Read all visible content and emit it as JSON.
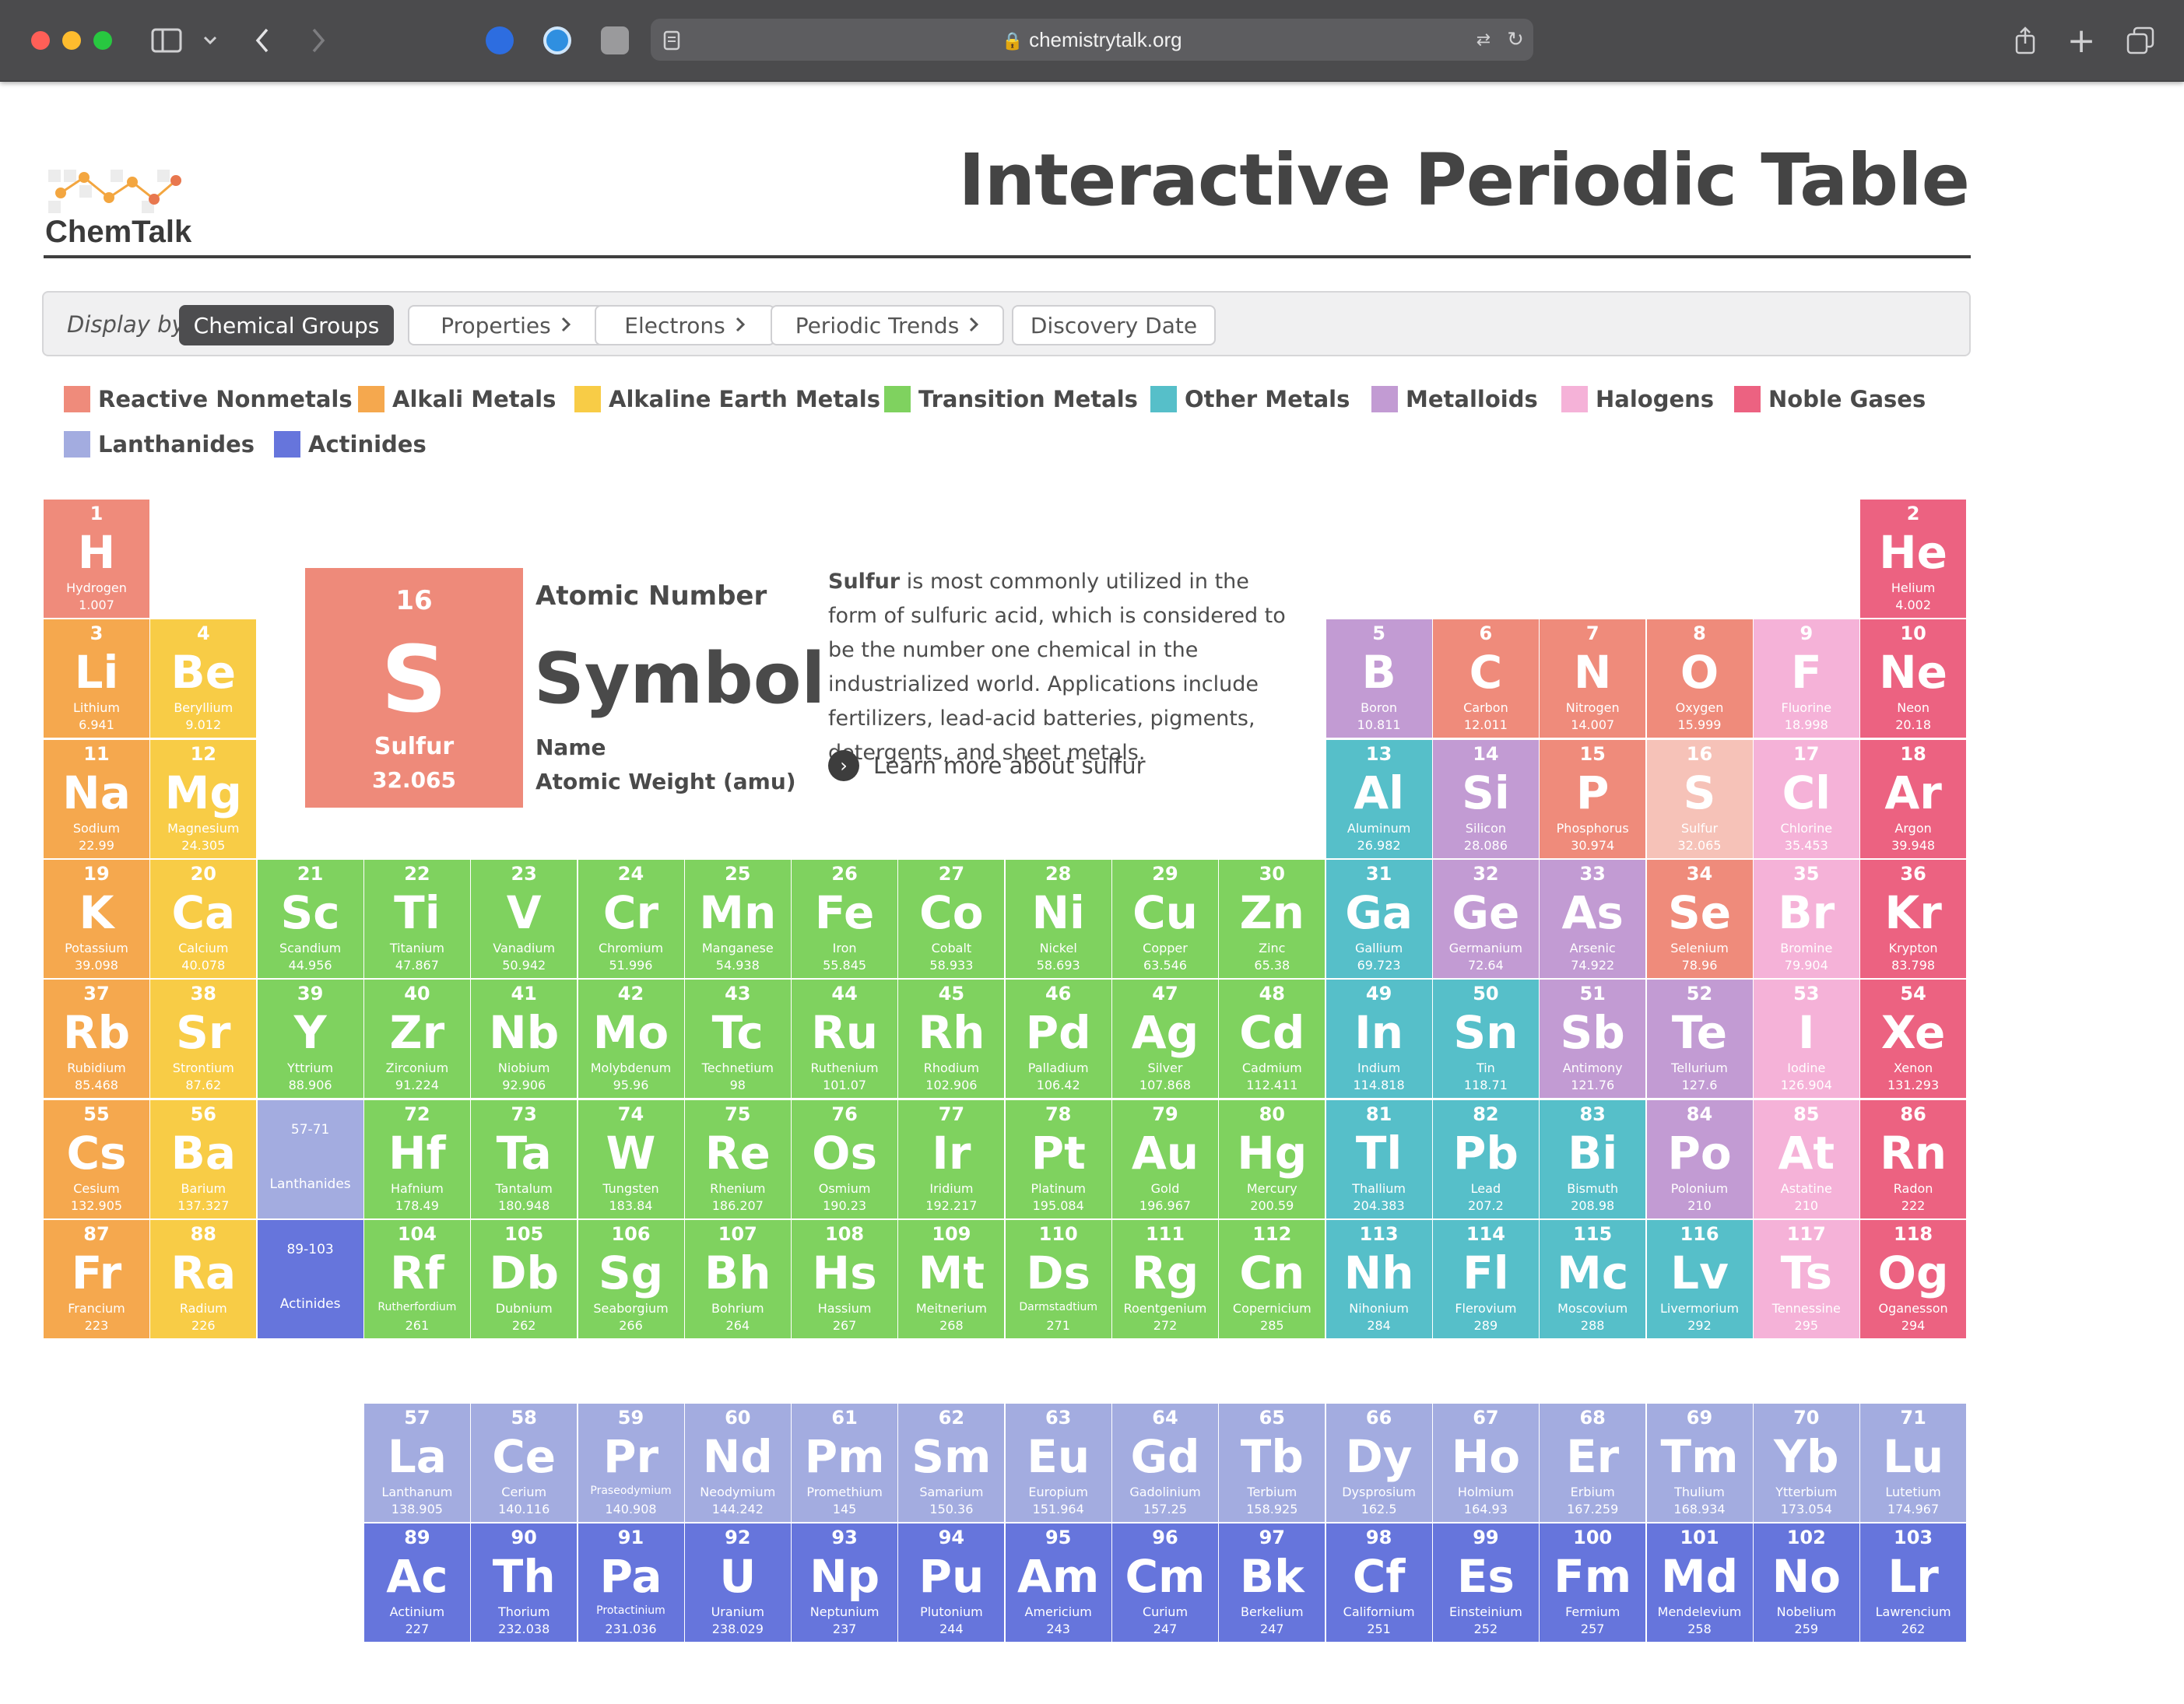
{
  "browser": {
    "url": "chemistrytalk.org"
  },
  "header": {
    "logo_text": "ChemTalk",
    "title": "Interactive Periodic Table"
  },
  "display_bar": {
    "label": "Display by",
    "buttons": [
      {
        "label": "Chemical Groups",
        "chevron": false,
        "active": true
      },
      {
        "label": "Properties",
        "chevron": true,
        "active": false
      },
      {
        "label": "Electrons",
        "chevron": true,
        "active": false
      },
      {
        "label": "Periodic Trends",
        "chevron": true,
        "active": false
      },
      {
        "label": "Discovery Date",
        "chevron": false,
        "active": false
      }
    ]
  },
  "legend": [
    {
      "key": "rn",
      "label": "Reactive Nonmetals"
    },
    {
      "key": "am",
      "label": "Alkali Metals"
    },
    {
      "key": "ae",
      "label": "Alkaline Earth Metals"
    },
    {
      "key": "tm",
      "label": "Transition Metals"
    },
    {
      "key": "om",
      "label": "Other Metals"
    },
    {
      "key": "md",
      "label": "Metalloids"
    },
    {
      "key": "ha",
      "label": "Halogens"
    },
    {
      "key": "ng",
      "label": "Noble Gases"
    },
    {
      "key": "la",
      "label": "Lanthanides"
    },
    {
      "key": "ac",
      "label": "Actinides"
    }
  ],
  "colors": {
    "rn": "#ef8b7b",
    "am": "#f5a84e",
    "ae": "#f8cc46",
    "tm": "#7fd25f",
    "om": "#56bfc9",
    "md": "#c29bd3",
    "ha": "#f5b2d8",
    "ng": "#ec6281",
    "la": "#a3ace0",
    "ac": "#6675dc",
    "selected": "#f6c2b8",
    "accent_dark": "#4d4d4f"
  },
  "detail": {
    "number": "16",
    "symbol": "S",
    "name": "Sulfur",
    "weight": "32.065",
    "captions": {
      "number": "Atomic Number",
      "symbol": "Symbol",
      "name": "Name",
      "weight": "Atomic Weight (amu)"
    },
    "description_bold": "Sulfur",
    "description": " is most commonly utilized in the form of sulfuric acid, which is considered to be the number one chemical in the industrialized world. Applications include fertilizers, lead-acid batteries, pigments, detergents, and sheet metals.",
    "link": "Learn more about sulfur"
  },
  "placeholders": [
    {
      "range": "57-71",
      "name": "Lanthanides",
      "cat": "la"
    },
    {
      "range": "89-103",
      "name": "Actinides",
      "cat": "ac"
    }
  ],
  "elements": [
    {
      "n": "1",
      "s": "H",
      "name": "Hydrogen",
      "w": "1.007",
      "cat": "rn"
    },
    {
      "n": "2",
      "s": "He",
      "name": "Helium",
      "w": "4.002",
      "cat": "ng"
    },
    {
      "n": "3",
      "s": "Li",
      "name": "Lithium",
      "w": "6.941",
      "cat": "am"
    },
    {
      "n": "4",
      "s": "Be",
      "name": "Beryllium",
      "w": "9.012",
      "cat": "ae"
    },
    {
      "n": "5",
      "s": "B",
      "name": "Boron",
      "w": "10.811",
      "cat": "md"
    },
    {
      "n": "6",
      "s": "C",
      "name": "Carbon",
      "w": "12.011",
      "cat": "rn"
    },
    {
      "n": "7",
      "s": "N",
      "name": "Nitrogen",
      "w": "14.007",
      "cat": "rn"
    },
    {
      "n": "8",
      "s": "O",
      "name": "Oxygen",
      "w": "15.999",
      "cat": "rn"
    },
    {
      "n": "9",
      "s": "F",
      "name": "Fluorine",
      "w": "18.998",
      "cat": "ha"
    },
    {
      "n": "10",
      "s": "Ne",
      "name": "Neon",
      "w": "20.18",
      "cat": "ng"
    },
    {
      "n": "11",
      "s": "Na",
      "name": "Sodium",
      "w": "22.99",
      "cat": "am"
    },
    {
      "n": "12",
      "s": "Mg",
      "name": "Magnesium",
      "w": "24.305",
      "cat": "ae"
    },
    {
      "n": "13",
      "s": "Al",
      "name": "Aluminum",
      "w": "26.982",
      "cat": "om"
    },
    {
      "n": "14",
      "s": "Si",
      "name": "Silicon",
      "w": "28.086",
      "cat": "md"
    },
    {
      "n": "15",
      "s": "P",
      "name": "Phosphorus",
      "w": "30.974",
      "cat": "rn"
    },
    {
      "n": "16",
      "s": "S",
      "name": "Sulfur",
      "w": "32.065",
      "cat": "selected"
    },
    {
      "n": "17",
      "s": "Cl",
      "name": "Chlorine",
      "w": "35.453",
      "cat": "ha"
    },
    {
      "n": "18",
      "s": "Ar",
      "name": "Argon",
      "w": "39.948",
      "cat": "ng"
    },
    {
      "n": "19",
      "s": "K",
      "name": "Potassium",
      "w": "39.098",
      "cat": "am"
    },
    {
      "n": "20",
      "s": "Ca",
      "name": "Calcium",
      "w": "40.078",
      "cat": "ae"
    },
    {
      "n": "21",
      "s": "Sc",
      "name": "Scandium",
      "w": "44.956",
      "cat": "tm"
    },
    {
      "n": "22",
      "s": "Ti",
      "name": "Titanium",
      "w": "47.867",
      "cat": "tm"
    },
    {
      "n": "23",
      "s": "V",
      "name": "Vanadium",
      "w": "50.942",
      "cat": "tm"
    },
    {
      "n": "24",
      "s": "Cr",
      "name": "Chromium",
      "w": "51.996",
      "cat": "tm"
    },
    {
      "n": "25",
      "s": "Mn",
      "name": "Manganese",
      "w": "54.938",
      "cat": "tm"
    },
    {
      "n": "26",
      "s": "Fe",
      "name": "Iron",
      "w": "55.845",
      "cat": "tm"
    },
    {
      "n": "27",
      "s": "Co",
      "name": "Cobalt",
      "w": "58.933",
      "cat": "tm"
    },
    {
      "n": "28",
      "s": "Ni",
      "name": "Nickel",
      "w": "58.693",
      "cat": "tm"
    },
    {
      "n": "29",
      "s": "Cu",
      "name": "Copper",
      "w": "63.546",
      "cat": "tm"
    },
    {
      "n": "30",
      "s": "Zn",
      "name": "Zinc",
      "w": "65.38",
      "cat": "tm"
    },
    {
      "n": "31",
      "s": "Ga",
      "name": "Gallium",
      "w": "69.723",
      "cat": "om"
    },
    {
      "n": "32",
      "s": "Ge",
      "name": "Germanium",
      "w": "72.64",
      "cat": "md"
    },
    {
      "n": "33",
      "s": "As",
      "name": "Arsenic",
      "w": "74.922",
      "cat": "md"
    },
    {
      "n": "34",
      "s": "Se",
      "name": "Selenium",
      "w": "78.96",
      "cat": "rn"
    },
    {
      "n": "35",
      "s": "Br",
      "name": "Bromine",
      "w": "79.904",
      "cat": "ha"
    },
    {
      "n": "36",
      "s": "Kr",
      "name": "Krypton",
      "w": "83.798",
      "cat": "ng"
    },
    {
      "n": "37",
      "s": "Rb",
      "name": "Rubidium",
      "w": "85.468",
      "cat": "am"
    },
    {
      "n": "38",
      "s": "Sr",
      "name": "Strontium",
      "w": "87.62",
      "cat": "ae"
    },
    {
      "n": "39",
      "s": "Y",
      "name": "Yttrium",
      "w": "88.906",
      "cat": "tm"
    },
    {
      "n": "40",
      "s": "Zr",
      "name": "Zirconium",
      "w": "91.224",
      "cat": "tm"
    },
    {
      "n": "41",
      "s": "Nb",
      "name": "Niobium",
      "w": "92.906",
      "cat": "tm"
    },
    {
      "n": "42",
      "s": "Mo",
      "name": "Molybdenum",
      "w": "95.96",
      "cat": "tm"
    },
    {
      "n": "43",
      "s": "Tc",
      "name": "Technetium",
      "w": "98",
      "cat": "tm"
    },
    {
      "n": "44",
      "s": "Ru",
      "name": "Ruthenium",
      "w": "101.07",
      "cat": "tm"
    },
    {
      "n": "45",
      "s": "Rh",
      "name": "Rhodium",
      "w": "102.906",
      "cat": "tm"
    },
    {
      "n": "46",
      "s": "Pd",
      "name": "Palladium",
      "w": "106.42",
      "cat": "tm"
    },
    {
      "n": "47",
      "s": "Ag",
      "name": "Silver",
      "w": "107.868",
      "cat": "tm"
    },
    {
      "n": "48",
      "s": "Cd",
      "name": "Cadmium",
      "w": "112.411",
      "cat": "tm"
    },
    {
      "n": "49",
      "s": "In",
      "name": "Indium",
      "w": "114.818",
      "cat": "om"
    },
    {
      "n": "50",
      "s": "Sn",
      "name": "Tin",
      "w": "118.71",
      "cat": "om"
    },
    {
      "n": "51",
      "s": "Sb",
      "name": "Antimony",
      "w": "121.76",
      "cat": "md"
    },
    {
      "n": "52",
      "s": "Te",
      "name": "Tellurium",
      "w": "127.6",
      "cat": "md"
    },
    {
      "n": "53",
      "s": "I",
      "name": "Iodine",
      "w": "126.904",
      "cat": "ha"
    },
    {
      "n": "54",
      "s": "Xe",
      "name": "Xenon",
      "w": "131.293",
      "cat": "ng"
    },
    {
      "n": "55",
      "s": "Cs",
      "name": "Cesium",
      "w": "132.905",
      "cat": "am"
    },
    {
      "n": "56",
      "s": "Ba",
      "name": "Barium",
      "w": "137.327",
      "cat": "ae"
    },
    {
      "n": "72",
      "s": "Hf",
      "name": "Hafnium",
      "w": "178.49",
      "cat": "tm"
    },
    {
      "n": "73",
      "s": "Ta",
      "name": "Tantalum",
      "w": "180.948",
      "cat": "tm"
    },
    {
      "n": "74",
      "s": "W",
      "name": "Tungsten",
      "w": "183.84",
      "cat": "tm"
    },
    {
      "n": "75",
      "s": "Re",
      "name": "Rhenium",
      "w": "186.207",
      "cat": "tm"
    },
    {
      "n": "76",
      "s": "Os",
      "name": "Osmium",
      "w": "190.23",
      "cat": "tm"
    },
    {
      "n": "77",
      "s": "Ir",
      "name": "Iridium",
      "w": "192.217",
      "cat": "tm"
    },
    {
      "n": "78",
      "s": "Pt",
      "name": "Platinum",
      "w": "195.084",
      "cat": "tm"
    },
    {
      "n": "79",
      "s": "Au",
      "name": "Gold",
      "w": "196.967",
      "cat": "tm"
    },
    {
      "n": "80",
      "s": "Hg",
      "name": "Mercury",
      "w": "200.59",
      "cat": "tm"
    },
    {
      "n": "81",
      "s": "Tl",
      "name": "Thallium",
      "w": "204.383",
      "cat": "om"
    },
    {
      "n": "82",
      "s": "Pb",
      "name": "Lead",
      "w": "207.2",
      "cat": "om"
    },
    {
      "n": "83",
      "s": "Bi",
      "name": "Bismuth",
      "w": "208.98",
      "cat": "om"
    },
    {
      "n": "84",
      "s": "Po",
      "name": "Polonium",
      "w": "210",
      "cat": "md"
    },
    {
      "n": "85",
      "s": "At",
      "name": "Astatine",
      "w": "210",
      "cat": "ha"
    },
    {
      "n": "86",
      "s": "Rn",
      "name": "Radon",
      "w": "222",
      "cat": "ng"
    },
    {
      "n": "87",
      "s": "Fr",
      "name": "Francium",
      "w": "223",
      "cat": "am"
    },
    {
      "n": "88",
      "s": "Ra",
      "name": "Radium",
      "w": "226",
      "cat": "ae"
    },
    {
      "n": "104",
      "s": "Rf",
      "name": "Rutherfordium",
      "w": "261",
      "cat": "tm"
    },
    {
      "n": "105",
      "s": "Db",
      "name": "Dubnium",
      "w": "262",
      "cat": "tm"
    },
    {
      "n": "106",
      "s": "Sg",
      "name": "Seaborgium",
      "w": "266",
      "cat": "tm"
    },
    {
      "n": "107",
      "s": "Bh",
      "name": "Bohrium",
      "w": "264",
      "cat": "tm"
    },
    {
      "n": "108",
      "s": "Hs",
      "name": "Hassium",
      "w": "267",
      "cat": "tm"
    },
    {
      "n": "109",
      "s": "Mt",
      "name": "Meitnerium",
      "w": "268",
      "cat": "tm"
    },
    {
      "n": "110",
      "s": "Ds",
      "name": "Darmstadtium",
      "w": "271",
      "cat": "tm"
    },
    {
      "n": "111",
      "s": "Rg",
      "name": "Roentgenium",
      "w": "272",
      "cat": "tm"
    },
    {
      "n": "112",
      "s": "Cn",
      "name": "Copernicium",
      "w": "285",
      "cat": "tm"
    },
    {
      "n": "113",
      "s": "Nh",
      "name": "Nihonium",
      "w": "284",
      "cat": "om"
    },
    {
      "n": "114",
      "s": "Fl",
      "name": "Flerovium",
      "w": "289",
      "cat": "om"
    },
    {
      "n": "115",
      "s": "Mc",
      "name": "Moscovium",
      "w": "288",
      "cat": "om"
    },
    {
      "n": "116",
      "s": "Lv",
      "name": "Livermorium",
      "w": "292",
      "cat": "om"
    },
    {
      "n": "117",
      "s": "Ts",
      "name": "Tennessine",
      "w": "295",
      "cat": "ha"
    },
    {
      "n": "118",
      "s": "Og",
      "name": "Oganesson",
      "w": "294",
      "cat": "ng"
    },
    {
      "n": "57",
      "s": "La",
      "name": "Lanthanum",
      "w": "138.905",
      "cat": "la"
    },
    {
      "n": "58",
      "s": "Ce",
      "name": "Cerium",
      "w": "140.116",
      "cat": "la"
    },
    {
      "n": "59",
      "s": "Pr",
      "name": "Praseodymium",
      "w": "140.908",
      "cat": "la"
    },
    {
      "n": "60",
      "s": "Nd",
      "name": "Neodymium",
      "w": "144.242",
      "cat": "la"
    },
    {
      "n": "61",
      "s": "Pm",
      "name": "Promethium",
      "w": "145",
      "cat": "la"
    },
    {
      "n": "62",
      "s": "Sm",
      "name": "Samarium",
      "w": "150.36",
      "cat": "la"
    },
    {
      "n": "63",
      "s": "Eu",
      "name": "Europium",
      "w": "151.964",
      "cat": "la"
    },
    {
      "n": "64",
      "s": "Gd",
      "name": "Gadolinium",
      "w": "157.25",
      "cat": "la"
    },
    {
      "n": "65",
      "s": "Tb",
      "name": "Terbium",
      "w": "158.925",
      "cat": "la"
    },
    {
      "n": "66",
      "s": "Dy",
      "name": "Dysprosium",
      "w": "162.5",
      "cat": "la"
    },
    {
      "n": "67",
      "s": "Ho",
      "name": "Holmium",
      "w": "164.93",
      "cat": "la"
    },
    {
      "n": "68",
      "s": "Er",
      "name": "Erbium",
      "w": "167.259",
      "cat": "la"
    },
    {
      "n": "69",
      "s": "Tm",
      "name": "Thulium",
      "w": "168.934",
      "cat": "la"
    },
    {
      "n": "70",
      "s": "Yb",
      "name": "Ytterbium",
      "w": "173.054",
      "cat": "la"
    },
    {
      "n": "71",
      "s": "Lu",
      "name": "Lutetium",
      "w": "174.967",
      "cat": "la"
    },
    {
      "n": "89",
      "s": "Ac",
      "name": "Actinium",
      "w": "227",
      "cat": "ac"
    },
    {
      "n": "90",
      "s": "Th",
      "name": "Thorium",
      "w": "232.038",
      "cat": "ac"
    },
    {
      "n": "91",
      "s": "Pa",
      "name": "Protactinium",
      "w": "231.036",
      "cat": "ac"
    },
    {
      "n": "92",
      "s": "U",
      "name": "Uranium",
      "w": "238.029",
      "cat": "ac"
    },
    {
      "n": "93",
      "s": "Np",
      "name": "Neptunium",
      "w": "237",
      "cat": "ac"
    },
    {
      "n": "94",
      "s": "Pu",
      "name": "Plutonium",
      "w": "244",
      "cat": "ac"
    },
    {
      "n": "95",
      "s": "Am",
      "name": "Americium",
      "w": "243",
      "cat": "ac"
    },
    {
      "n": "96",
      "s": "Cm",
      "name": "Curium",
      "w": "247",
      "cat": "ac"
    },
    {
      "n": "97",
      "s": "Bk",
      "name": "Berkelium",
      "w": "247",
      "cat": "ac"
    },
    {
      "n": "98",
      "s": "Cf",
      "name": "Californium",
      "w": "251",
      "cat": "ac"
    },
    {
      "n": "99",
      "s": "Es",
      "name": "Einsteinium",
      "w": "252",
      "cat": "ac"
    },
    {
      "n": "100",
      "s": "Fm",
      "name": "Fermium",
      "w": "257",
      "cat": "ac"
    },
    {
      "n": "101",
      "s": "Md",
      "name": "Mendelevium",
      "w": "258",
      "cat": "ac"
    },
    {
      "n": "102",
      "s": "No",
      "name": "Nobelium",
      "w": "259",
      "cat": "ac"
    },
    {
      "n": "103",
      "s": "Lr",
      "name": "Lawrencium",
      "w": "262",
      "cat": "ac"
    }
  ]
}
